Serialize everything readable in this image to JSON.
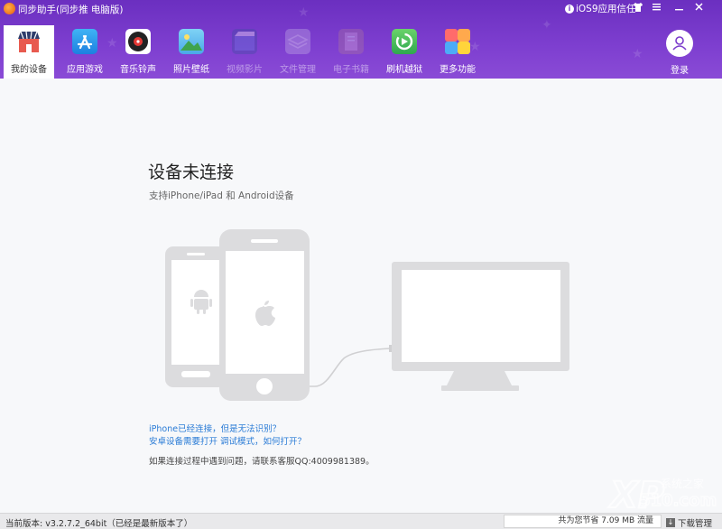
{
  "window": {
    "title": "同步助手(同步推 电脑版)",
    "ios_trust_label": "iOS9应用信任",
    "controls": [
      "shirt-icon",
      "menu-icon",
      "minimize-icon",
      "close-icon"
    ]
  },
  "nav": {
    "items": [
      {
        "label": "我的设备",
        "icon": "store-icon",
        "active": true
      },
      {
        "label": "应用游戏",
        "icon": "app-store-icon"
      },
      {
        "label": "音乐铃声",
        "icon": "music-disc-icon"
      },
      {
        "label": "照片壁纸",
        "icon": "photo-icon"
      },
      {
        "label": "视频影片",
        "icon": "video-icon",
        "disabled": true
      },
      {
        "label": "文件管理",
        "icon": "file-icon",
        "disabled": true
      },
      {
        "label": "电子书籍",
        "icon": "ebook-icon",
        "disabled": true
      },
      {
        "label": "刷机越狱",
        "icon": "flash-icon"
      },
      {
        "label": "更多功能",
        "icon": "more-icon"
      }
    ],
    "login_label": "登录"
  },
  "main": {
    "heading": "设备未连接",
    "subheading": "支持iPhone/iPad 和 Android设备",
    "link_iphone": "iPhone已经连接，但是无法识别？",
    "link_android": "安卓设备需要打开 调试模式，如何打开？",
    "help": "如果连接过程中遇到问题，请联系客服QQ:4009981389。"
  },
  "statusbar": {
    "version": "当前版本: v3.2.7.2_64bit（已经是最新版本了）",
    "saved": "共为您节省 7.09 MB 流量",
    "download_manager": "下载管理"
  },
  "watermark": {
    "text": "XP",
    "sub": "系统之家",
    "num": "510.com"
  },
  "colors": {
    "header": "#7b3bcc",
    "link": "#2a7bd6",
    "illustration": "#dcdcde"
  }
}
